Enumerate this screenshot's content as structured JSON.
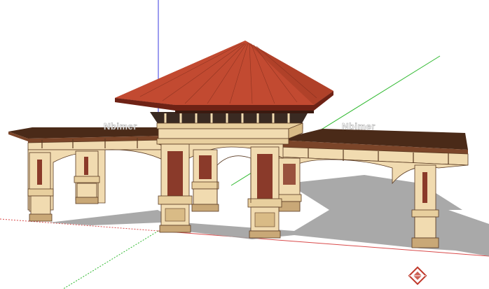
{
  "watermarks": [
    "Nbimer",
    "Nbimer"
  ],
  "colors": {
    "background": "#ffffff",
    "roof_red": "#b5412c",
    "roof_dark": "#6e2215",
    "pergola_wood": "#6b3b24",
    "column_cream": "#f1dbb0",
    "column_shade": "#c9a877",
    "panel_red": "#8a3a2a",
    "shadow": "#9c9c9c",
    "axis_red": "#d94a4a",
    "axis_green": "#2fb92f",
    "axis_blue": "#3a3adf"
  },
  "icons": {
    "corner_logo": "nbimer-diamond-logo-icon"
  }
}
